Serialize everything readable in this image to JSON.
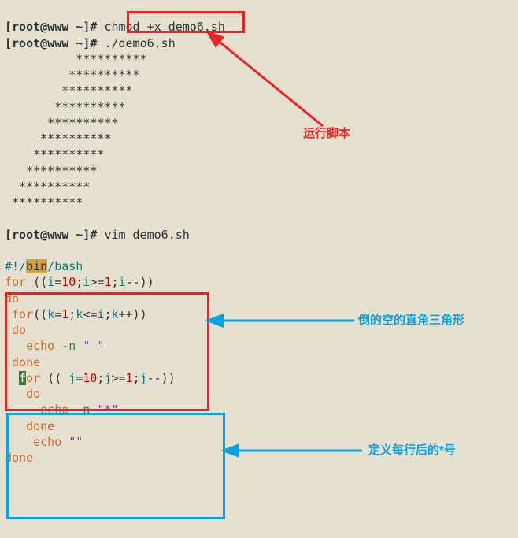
{
  "prompt": "[root@www ~]#",
  "cmd_chmod": "chmod +x demo6.sh",
  "cmd_run": "./demo6.sh",
  "output_triangle": [
    "          **********",
    "         **********",
    "        **********",
    "       **********",
    "      **********",
    "     **********",
    "    **********",
    "   **********",
    "  **********",
    " **********"
  ],
  "cmd_vim": "vim demo6.sh",
  "shebang_prefix": "#!/",
  "shebang_bin": "bin",
  "shebang_bash": "/bash",
  "script": {
    "l1_for": "for",
    "l1_open": " ((",
    "l1_i": "i",
    "l1_a1": "=",
    "l1_n10": "10",
    "l1_a2": ";",
    "l1_i2": "i",
    "l1_a3": ">=",
    "l1_n1": "1",
    "l1_a4": ";",
    "l1_i3": "i",
    "l1_a5": "--))",
    "l2_do": "do",
    "l3_sp": " ",
    "l3_for": "for",
    "l3_open": "((",
    "l3_k": "k",
    "l3_a1": "=",
    "l3_n1": "1",
    "l3_a2": ";",
    "l3_k2": "k",
    "l3_a3": "<=",
    "l3_i": "i",
    "l3_a4": ";",
    "l3_k3": "k",
    "l3_a5": "++))",
    "l4_sp": " ",
    "l4_do": "do",
    "l5_sp": "   ",
    "l5_echo": "echo",
    "l5_flag": " -n ",
    "l5_str": "\" \"",
    "l6_sp": " ",
    "l6_done": "done",
    "l7_sp": "  ",
    "l7_for": "or",
    "l7_open": " (( ",
    "l7_j": "j",
    "l7_a1": "=",
    "l7_n10": "10",
    "l7_a2": ";",
    "l7_j2": "j",
    "l7_a3": ">=",
    "l7_n1": "1",
    "l7_a4": ";",
    "l7_j3": "j",
    "l7_a5": "--))",
    "l8_sp": "   ",
    "l8_do": "do",
    "l9_sp": "     ",
    "l9_echo": "echo",
    "l9_flag": " -n ",
    "l9_str": "\"*\"",
    "l10_sp": "   ",
    "l10_done": "done",
    "l11_sp": "    ",
    "l11_echo": "echo",
    "l11_sp2": " ",
    "l11_str": "\"\"",
    "l12_done": "done"
  },
  "annotations": {
    "run_script": "运行脚本",
    "inverted_triangle": "倒的空的直角三角形",
    "define_stars": "定义每行后的*号"
  },
  "colors": {
    "red": "#e22",
    "blue": "#0aa3e0"
  }
}
